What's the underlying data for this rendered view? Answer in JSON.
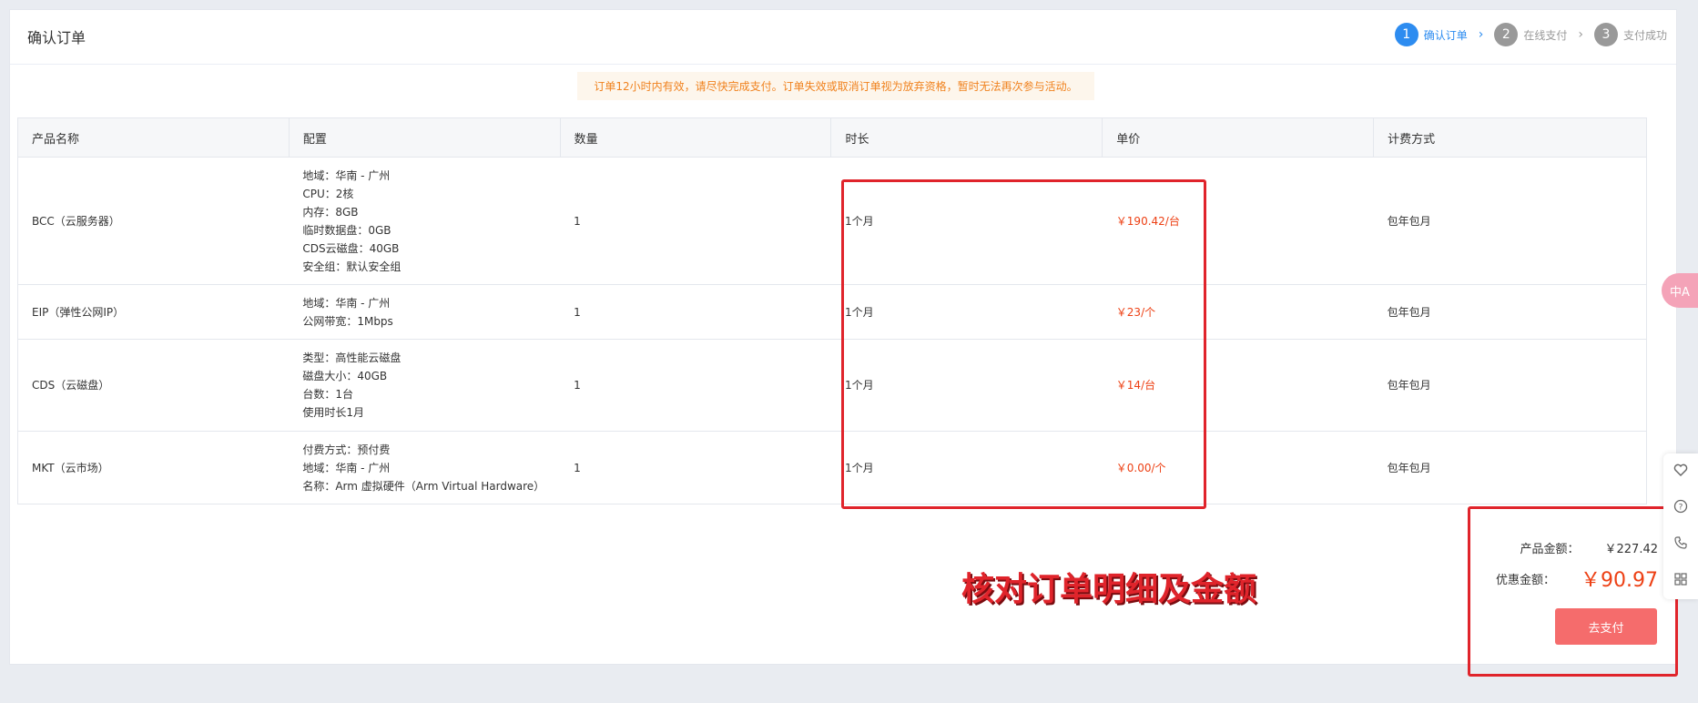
{
  "page": {
    "title": "确认订单"
  },
  "steps": [
    {
      "num": "1",
      "label": "确认订单"
    },
    {
      "num": "2",
      "label": "在线支付"
    },
    {
      "num": "3",
      "label": "支付成功"
    }
  ],
  "notice": "订单12小时内有效，请尽快完成支付。订单失效或取消订单视为放弃资格，暂时无法再次参与活动。",
  "table": {
    "headers": [
      "产品名称",
      "配置",
      "数量",
      "时长",
      "单价",
      "计费方式"
    ],
    "rows": [
      {
        "name": "BCC（云服务器）",
        "config": [
          "地域：华南 - 广州",
          "CPU：2核",
          "内存：8GB",
          "临时数据盘：0GB",
          "CDS云磁盘：40GB",
          "安全组：默认安全组"
        ],
        "qty": "1",
        "duration": "1个月",
        "price": "￥190.42/台",
        "billing": "包年包月"
      },
      {
        "name": "EIP（弹性公网IP）",
        "config": [
          "地域：华南 - 广州",
          "公网带宽：1Mbps"
        ],
        "qty": "1",
        "duration": "1个月",
        "price": "￥23/个",
        "billing": "包年包月"
      },
      {
        "name": "CDS（云磁盘）",
        "config": [
          "类型：高性能云磁盘",
          "磁盘大小：40GB",
          "台数：1台",
          "使用时长1月"
        ],
        "qty": "1",
        "duration": "1个月",
        "price": "￥14/台",
        "billing": "包年包月"
      },
      {
        "name": "MKT（云市场）",
        "config": [
          "付费方式：预付费",
          "地域：华南 - 广州",
          "名称：Arm 虚拟硬件（Arm Virtual Hardware）"
        ],
        "qty": "1",
        "duration": "1个月",
        "price": "￥0.00/个",
        "billing": "包年包月"
      }
    ]
  },
  "summary": {
    "product_label": "产品金额：",
    "product_value": "￥227.42",
    "discount_label": "优惠金额：",
    "discount_value": "￥90.97",
    "pay_button": "去支付"
  },
  "annotation": "核对订单明细及金额",
  "side_tools": {
    "translate": "中A",
    "icons": [
      "heart-icon",
      "help-icon",
      "phone-icon",
      "grid-icon"
    ]
  },
  "colors": {
    "accent": "#2d8cf0",
    "price": "#ed4014",
    "pay_button": "#f56c6c",
    "annotation": "#e0242b"
  }
}
